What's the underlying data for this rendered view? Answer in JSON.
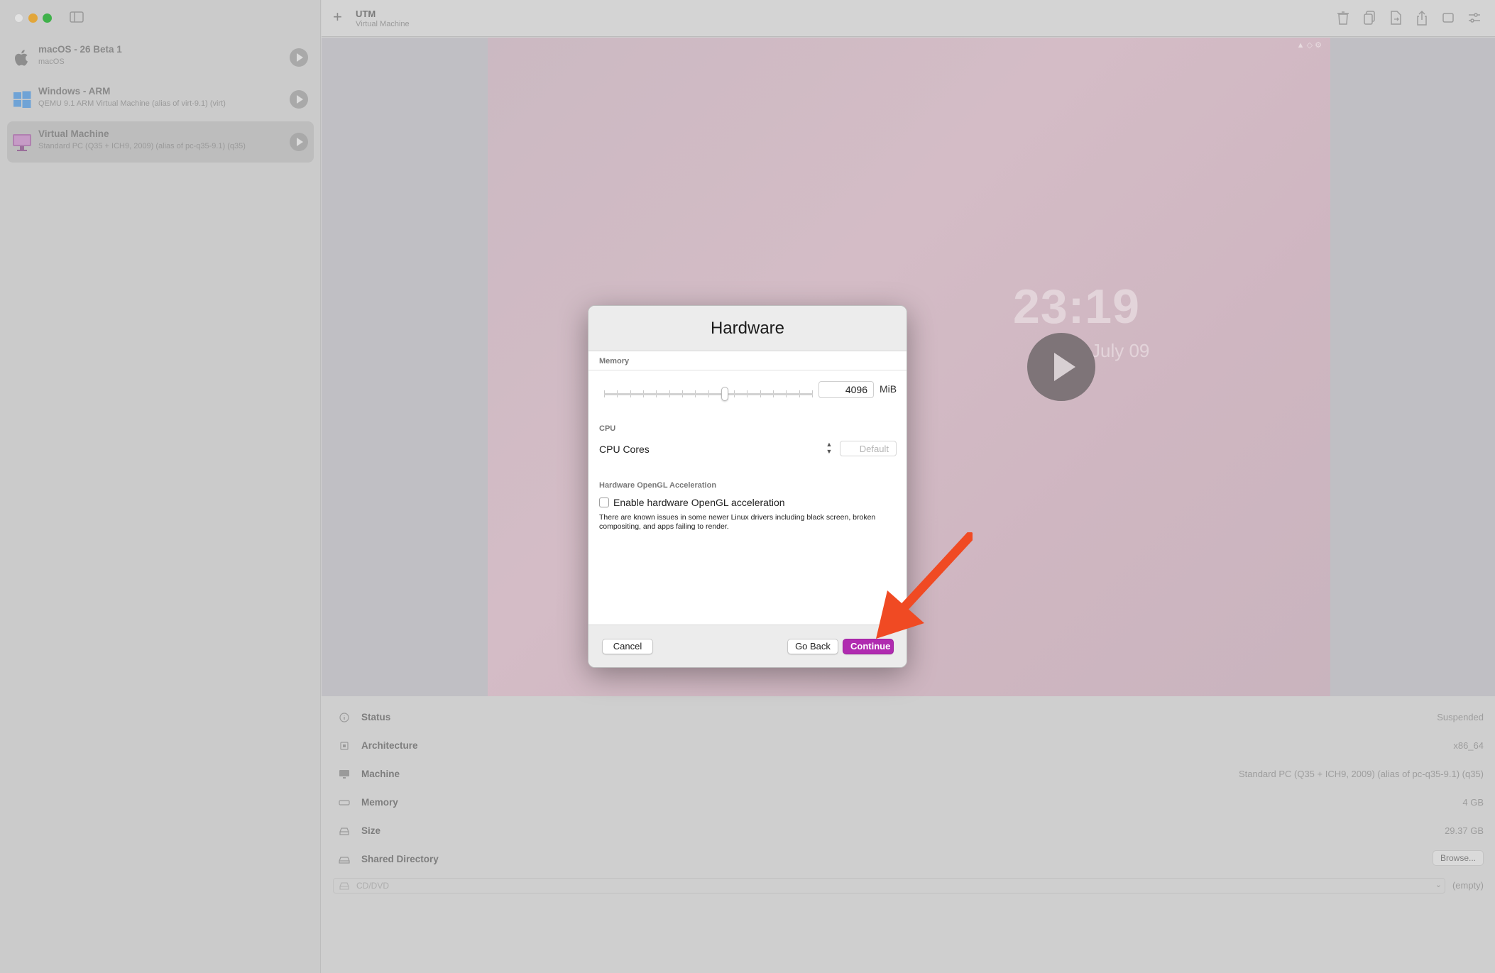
{
  "colors": {
    "accent": "#b02bb0",
    "annotation_arrow": "#f04a23",
    "traffic_min": "#e2a63a",
    "traffic_max": "#3fb14a"
  },
  "sidebar": {
    "items": [
      {
        "name": "macOS - 26 Beta 1",
        "subtitle": "macOS",
        "icon": "apple-icon"
      },
      {
        "name": "Windows - ARM",
        "subtitle": "QEMU 9.1 ARM Virtual Machine (alias of virt-9.1) (virt)",
        "icon": "windows-icon"
      },
      {
        "name": "Virtual Machine",
        "subtitle": "Standard PC (Q35 + ICH9, 2009) (alias of pc-q35-9.1) (q35)",
        "icon": "monitor-icon"
      }
    ]
  },
  "toolbar": {
    "title": "UTM",
    "subtitle": "Virtual Machine",
    "add_label": "+"
  },
  "preview": {
    "clock": "23:19",
    "date": "July 09"
  },
  "details": {
    "rows": [
      {
        "label": "Status",
        "value": "Suspended"
      },
      {
        "label": "Architecture",
        "value": "x86_64"
      },
      {
        "label": "Machine",
        "value": "Standard PC (Q35 + ICH9, 2009) (alias of pc-q35-9.1) (q35)"
      },
      {
        "label": "Memory",
        "value": "4 GB"
      },
      {
        "label": "Size",
        "value": "29.37 GB"
      },
      {
        "label": "Shared Directory",
        "value": ""
      }
    ],
    "browse_label": "Browse...",
    "cd_label": "CD/DVD",
    "cd_value": "(empty)"
  },
  "dialog": {
    "title": "Hardware",
    "memory_section": "Memory",
    "memory_value": "4096",
    "memory_unit": "MiB",
    "memory_slider_fraction": 0.58,
    "cpu_section": "CPU",
    "cpu_cores_label": "CPU Cores",
    "cpu_cores_placeholder": "Default",
    "opengl_section": "Hardware OpenGL Acceleration",
    "opengl_checkbox_label": "Enable hardware OpenGL acceleration",
    "opengl_checked": false,
    "opengl_note": "There are known issues in some newer Linux drivers including black screen, broken compositing, and apps failing to render.",
    "cancel_label": "Cancel",
    "back_label": "Go Back",
    "continue_label": "Continue"
  }
}
